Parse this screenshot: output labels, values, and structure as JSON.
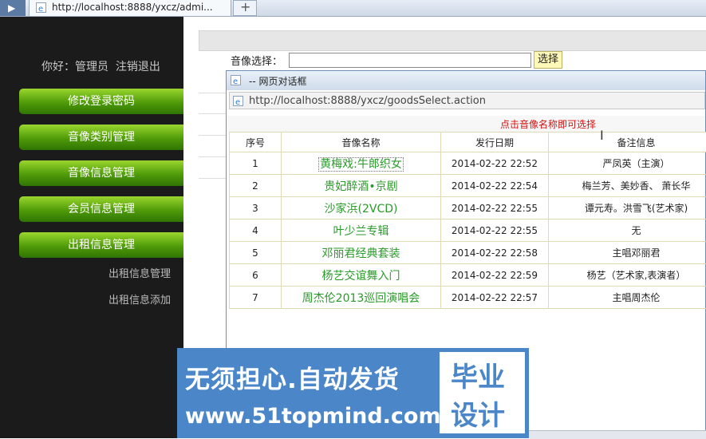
{
  "browser": {
    "tab_url": "http://localhost:8888/yxcz/admi...",
    "new_tab": "+"
  },
  "sidebar": {
    "greeting": "你好：管理员",
    "logout": "注销退出",
    "menu": [
      {
        "label": "修改登录密码"
      },
      {
        "label": "音像类别管理"
      },
      {
        "label": "音像信息管理"
      },
      {
        "label": "会员信息管理"
      },
      {
        "label": "出租信息管理"
      }
    ],
    "subitems": [
      {
        "label": "出租信息管理"
      },
      {
        "label": "出租信息添加"
      }
    ]
  },
  "form": {
    "image_label": "音像选择：",
    "image_value": "",
    "select_button": "选择"
  },
  "dialog": {
    "title": "-- 网页对话框",
    "url": "http://localhost:8888/yxcz/goodsSelect.action",
    "hint": "点击音像名称即可选择",
    "columns": [
      "序号",
      "音像名称",
      "发行日期",
      "备注信息"
    ],
    "rows": [
      {
        "no": "1",
        "name": "黄梅戏:牛郎织女",
        "date": "2014-02-22 22:52",
        "note": "严凤英（主演）"
      },
      {
        "no": "2",
        "name": "贵妃醉酒•京剧",
        "date": "2014-02-22 22:54",
        "note": "梅兰芳、美妙香、 萧长华"
      },
      {
        "no": "3",
        "name": "沙家浜(2VCD)",
        "date": "2014-02-22 22:55",
        "note": "谭元寿。洪雪飞(艺术家)"
      },
      {
        "no": "4",
        "name": "叶少兰专辑",
        "date": "2014-02-22 22:55",
        "note": "无"
      },
      {
        "no": "5",
        "name": "邓丽君经典套装",
        "date": "2014-02-22 22:58",
        "note": "主唱邓丽君"
      },
      {
        "no": "6",
        "name": "杨艺交谊舞入门",
        "date": "2014-02-22 22:59",
        "note": "杨艺（艺术家,表演者）"
      },
      {
        "no": "7",
        "name": "周杰伦2013巡回演唱会",
        "date": "2014-02-22 22:57",
        "note": "主唱周杰伦"
      }
    ]
  },
  "banner": {
    "line1": "无须担心.自动发货",
    "line2": "www.51topmind.com",
    "box_line1": "毕业",
    "box_line2": "设计"
  },
  "colors": {
    "menu_green": "#4f9b09",
    "name_green": "#2a9a2a",
    "hint_red": "#d31313",
    "banner_blue": "#4a86c8"
  }
}
